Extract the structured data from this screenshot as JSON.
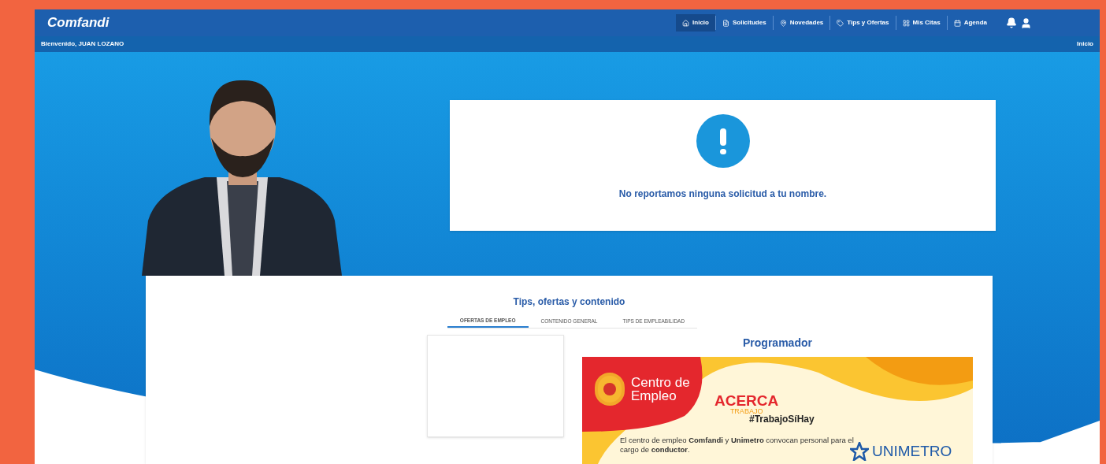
{
  "header": {
    "logo": "Comfandi",
    "nav": [
      {
        "label": "Inicio",
        "selected": true
      },
      {
        "label": "Solicitudes",
        "selected": false
      },
      {
        "label": "Novedades",
        "selected": false
      },
      {
        "label": "Tips y Ofertas",
        "selected": false
      },
      {
        "label": "Mis Citas",
        "selected": false
      },
      {
        "label": "Agenda",
        "selected": false
      }
    ]
  },
  "subbar": {
    "welcome": "Bienvenido, JUAN LOZANO",
    "breadcrumb": "Inicio"
  },
  "notice": {
    "message": "No reportamos ninguna solicitud a tu nombre."
  },
  "content": {
    "title": "Tips, ofertas y contenido",
    "tabs": [
      {
        "label": "OFERTAS DE EMPLEO",
        "selected": true
      },
      {
        "label": "CONTENIDO GENERAL",
        "selected": false
      },
      {
        "label": "TIPS DE EMPLEABILIDAD",
        "selected": false
      }
    ],
    "banner": {
      "heading": "Programador",
      "brand": "Centro de Empleo",
      "campaign": "ACERCA",
      "campaign_sub": "TRABAJO",
      "hashtag": "#TrabajoSíHay",
      "text": "El centro de empleo **Comfandi** y **Unimetro** convocan personal para el cargo de **conductor**.",
      "partner": "UNIMETRO"
    }
  }
}
